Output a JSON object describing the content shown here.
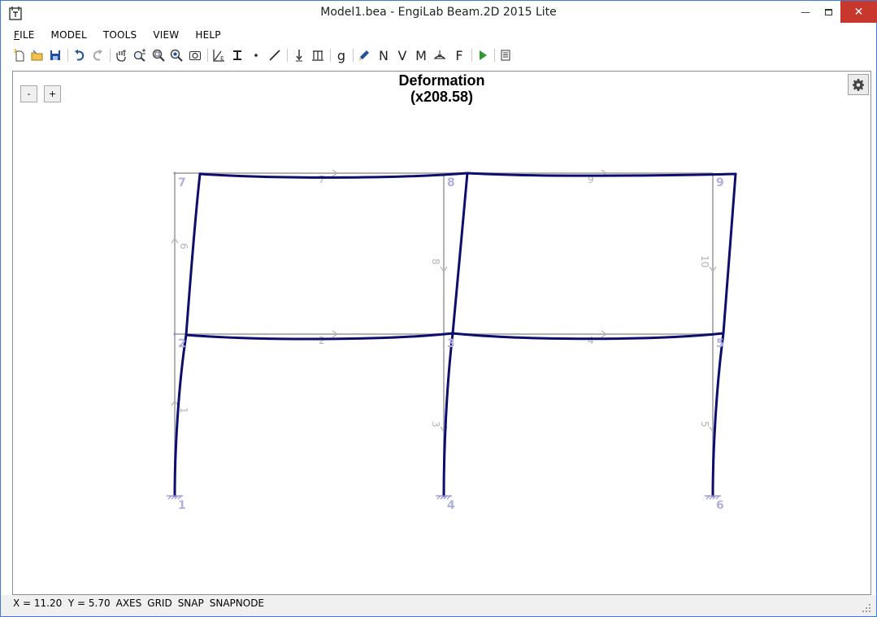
{
  "window": {
    "title": "Model1.bea - EngiLab Beam.2D 2015 Lite",
    "minimize_label": "—",
    "close_label": "✕"
  },
  "menu": {
    "items": [
      {
        "underlined": "F",
        "rest": "ILE"
      },
      {
        "underlined": "",
        "rest": "MODEL"
      },
      {
        "underlined": "",
        "rest": "TOOLS"
      },
      {
        "underlined": "",
        "rest": "VIEW"
      },
      {
        "underlined": "",
        "rest": "HELP"
      }
    ]
  },
  "toolbar": {
    "letters": {
      "g": "g",
      "n": "N",
      "v": "V",
      "m": "M",
      "f": "F"
    }
  },
  "canvas": {
    "zoom_out_label": "-",
    "zoom_in_label": "+",
    "title_line1": "Deformation",
    "title_line2": "(x208.58)",
    "nodes": [
      "1",
      "2",
      "3",
      "4",
      "5",
      "6",
      "7",
      "8",
      "9"
    ],
    "element_labels": [
      "1",
      "2",
      "3",
      "4",
      "5",
      "6",
      "7",
      "8",
      "9",
      "10"
    ]
  },
  "colors": {
    "deformed": "#0d0d6e",
    "undeformed": "#b3b3b3",
    "node_label": "#b0b0e0",
    "element_label": "#b3b3b3",
    "support": "#8c8cd8",
    "play": "#2e9a2e",
    "close": "#c7372b"
  },
  "status": {
    "coords": "X = 11.20  Y = 5.70",
    "axes": "AXES",
    "grid": "GRID",
    "snap": "SNAP",
    "snapnode": "SNAPNODE"
  }
}
